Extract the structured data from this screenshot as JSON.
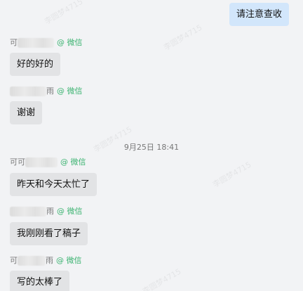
{
  "outgoing": [
    {
      "text": "请注意查收"
    }
  ],
  "messages": [
    {
      "name_prefix": "可",
      "name_suffix": "",
      "source": "@ 微信",
      "text": "好的好的"
    },
    {
      "name_prefix": "",
      "name_suffix": "雨",
      "source": "@ 微信",
      "text": "谢谢"
    },
    {
      "name_prefix": "可可",
      "name_suffix": "",
      "source": "@ 微信",
      "text": "昨天和今天太忙了"
    },
    {
      "name_prefix": "",
      "name_suffix": "雨",
      "source": "@ 微信",
      "text": "我刚刚看了稿子"
    },
    {
      "name_prefix": "可",
      "name_suffix": "雨",
      "source": "@ 微信",
      "text": "写的太棒了"
    }
  ],
  "timestamp": "9月25日 18:41",
  "watermark": "李圆梦4715",
  "colors": {
    "background": "#f2f3f5",
    "outgoing_bubble": "#d2e6fb",
    "incoming_bubble": "#e2e3e5",
    "wechat_green": "#3cb371"
  }
}
